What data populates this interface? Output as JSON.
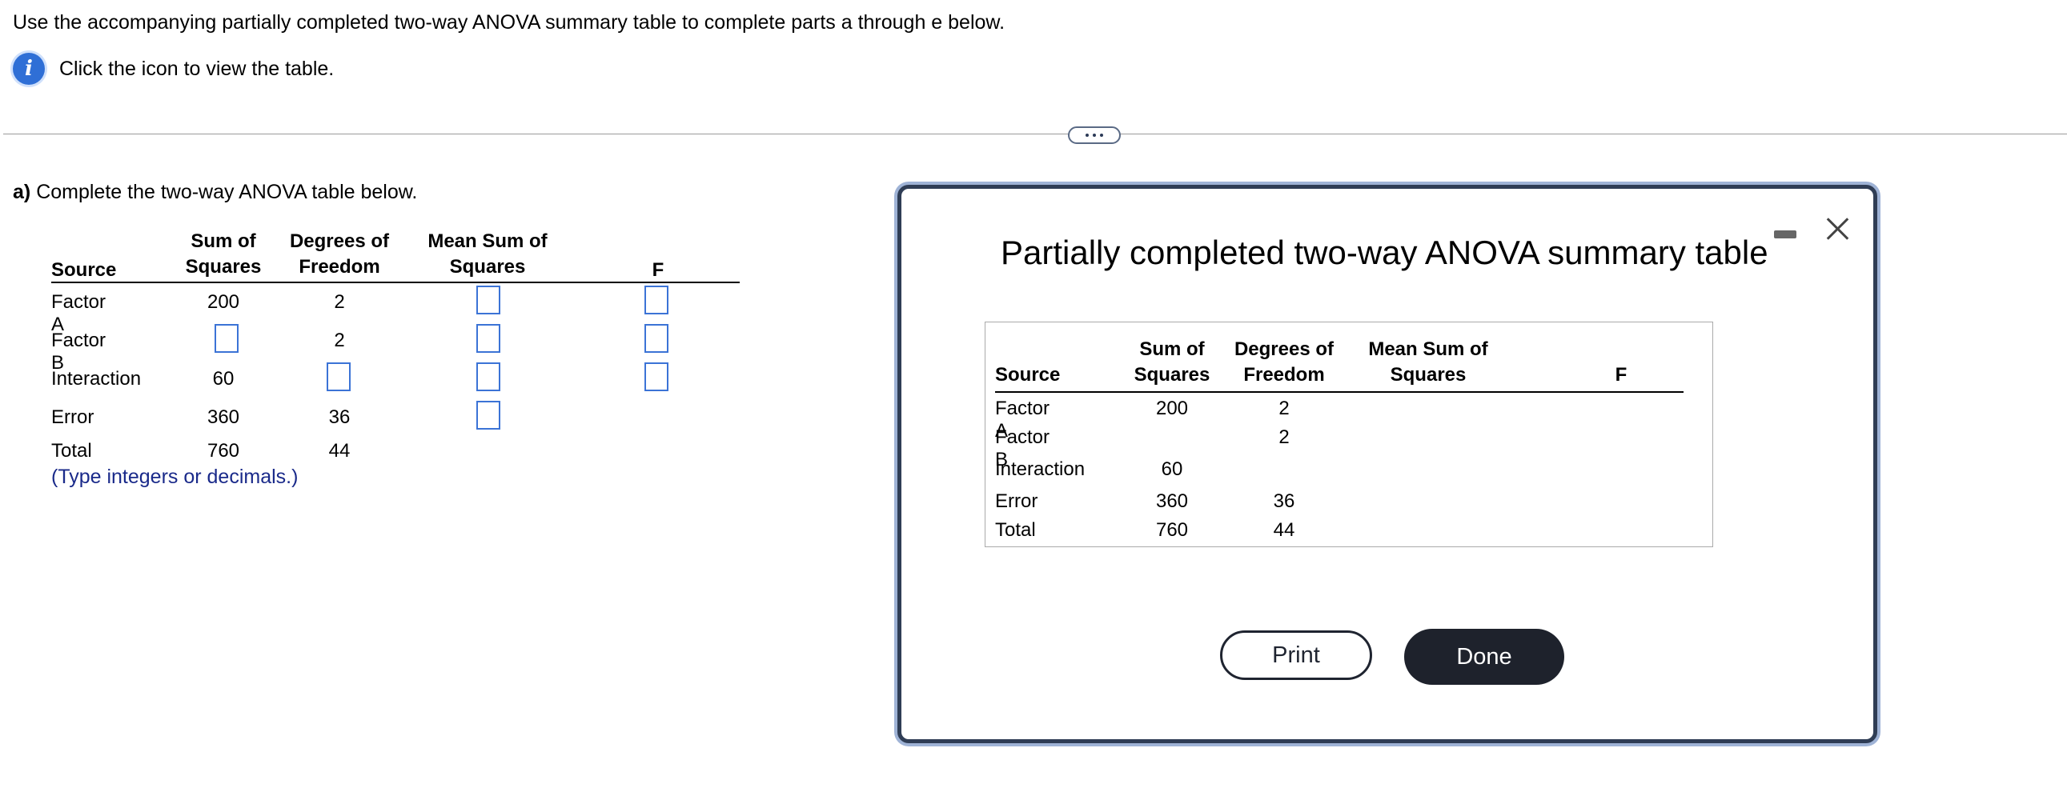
{
  "instructions": "Use the accompanying partially completed two-way ANOVA summary table to complete parts a through e below.",
  "info_link": "Click the icon to view the table.",
  "part_a": {
    "label": "a)",
    "text": "Complete the two-way ANOVA table below."
  },
  "columns": {
    "source": "Source",
    "ss_line1": "Sum of",
    "ss_line2": "Squares",
    "df_line1": "Degrees of",
    "df_line2": "Freedom",
    "ms_line1": "Mean Sum of",
    "ms_line2": "Squares",
    "f": "F"
  },
  "rows": [
    {
      "source": "Factor A",
      "ss": "200",
      "df": "2"
    },
    {
      "source": "Factor B",
      "ss": "",
      "df": "2"
    },
    {
      "source": "Interaction",
      "ss": "60",
      "df": ""
    },
    {
      "source": "Error",
      "ss": "360",
      "df": "36"
    },
    {
      "source": "Total",
      "ss": "760",
      "df": "44"
    }
  ],
  "hint": "(Type integers or decimals.)",
  "popup": {
    "title": "Partially completed two-way ANOVA summary table",
    "print_label": "Print",
    "done_label": "Done"
  }
}
